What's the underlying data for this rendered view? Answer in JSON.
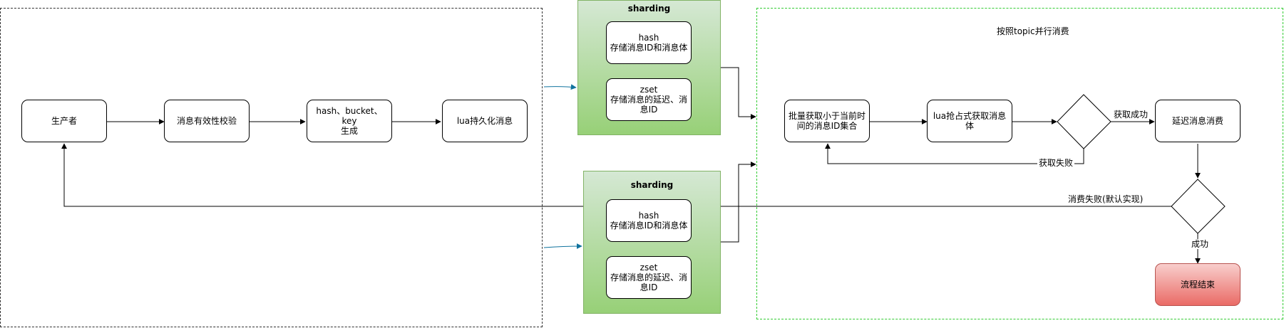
{
  "sharding_title": "sharding",
  "nodes": {
    "producer": "生产者",
    "validate": "消息有效性校验",
    "keygen": "hash、bucket、key\n生成",
    "persist": "lua持久化消息",
    "hash_top": "hash\n存储消息ID和消息体",
    "zset_top": "zset\n存储消息的延迟、消\n息ID",
    "hash_bottom": "hash\n存储消息ID和消息体",
    "zset_bottom": "zset\n存储消息的延迟、消\n息ID",
    "batch_fetch": "批量获取小于当前时\n间的消息ID集合",
    "grab": "lua抢占式获取消息体",
    "consume": "延迟消息消费",
    "end": "流程结束"
  },
  "labels": {
    "consumer_region": "按照topic并行消费",
    "fetch_success": "获取成功",
    "fetch_fail": "获取失败",
    "consume_fail": "消费失败(默认实现)",
    "success": "成功"
  },
  "colors": {
    "panel_border": "#82b366",
    "panel_fill_top": "#d5e8d4",
    "panel_fill_bottom": "#97d077",
    "end_fill_top": "#f8cecc",
    "end_fill_bottom": "#ea6b66",
    "consumer_region_border": "#33cc33",
    "blue_arrow": "#10739e"
  }
}
